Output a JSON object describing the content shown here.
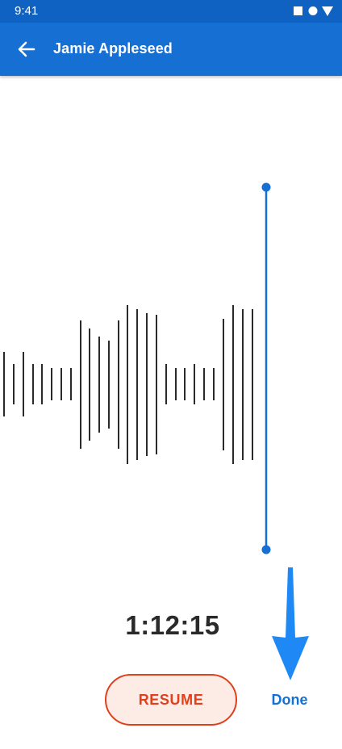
{
  "status_bar": {
    "time": "9:41",
    "icons": [
      "square-icon",
      "circle-icon",
      "triangle-down-icon"
    ]
  },
  "app_bar": {
    "back_icon": "arrow-left-icon",
    "title": "Jamie Appleseed"
  },
  "recording": {
    "elapsed": "1:12:15"
  },
  "actions": {
    "resume_label": "RESUME",
    "done_label": "Done"
  },
  "colors": {
    "app_bar": "#1670d4",
    "status_bar": "#0f62c2",
    "accent": "#1670d4",
    "resume": "#e0401c",
    "resume_fill": "#fdebe6",
    "waveform": "#2a2a2a",
    "arrow": "#1e88f5"
  }
}
